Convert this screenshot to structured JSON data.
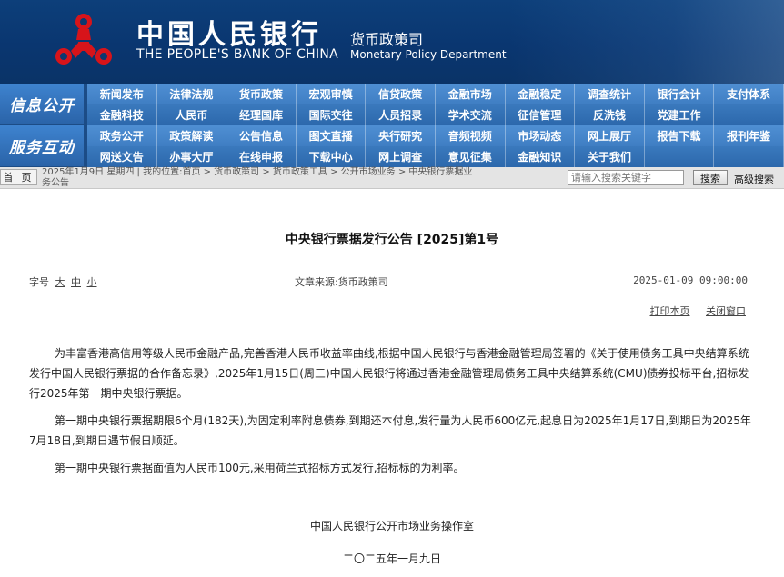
{
  "header": {
    "bank_name_cn": "中国人民银行",
    "bank_name_en": "THE PEOPLE'S BANK OF CHINA",
    "dept_cn": "货币政策司",
    "dept_en": "Monetary Policy Department",
    "brand_color": "#0a3670",
    "logo_color": "#d7141a"
  },
  "nav": {
    "section1": "信息公开",
    "section2": "服务互动",
    "rows": [
      [
        "新闻发布",
        "法律法规",
        "货币政策",
        "宏观审慎",
        "信贷政策",
        "金融市场",
        "金融稳定",
        "调查统计",
        "银行会计",
        "支付体系"
      ],
      [
        "金融科技",
        "人民币",
        "经理国库",
        "国际交往",
        "人员招录",
        "学术交流",
        "征信管理",
        "反洗钱",
        "党建工作",
        ""
      ],
      [
        "政务公开",
        "政策解读",
        "公告信息",
        "图文直播",
        "央行研究",
        "音频视频",
        "市场动态",
        "网上展厅",
        "报告下载",
        "报刊年鉴"
      ],
      [
        "网送文告",
        "办事大厅",
        "在线申报",
        "下载中心",
        "网上调查",
        "意见征集",
        "金融知识",
        "关于我们",
        "",
        ""
      ]
    ]
  },
  "breadcrumb": {
    "home_label": "首 页",
    "line1": "2025年1月9日 星期四 | 我的位置:首页 > 货币政策司 > 货币政策工具 > 公开市场业务 > 中央银行票据业",
    "line2": "务公告",
    "search_placeholder": "请输入搜索关键字",
    "search_button": "搜索",
    "advanced_search": "高级搜索"
  },
  "article": {
    "title": "中央银行票据发行公告 [2025]第1号",
    "font_size_label": "字号",
    "font_large": "大",
    "font_medium": "中",
    "font_small": "小",
    "source": "文章来源:货币政策司",
    "date": "2025-01-09 09:00:00",
    "print_label": "打印本页",
    "close_label": "关闭窗口",
    "paragraphs": [
      "为丰富香港高信用等级人民币金融产品,完善香港人民币收益率曲线,根据中国人民银行与香港金融管理局签署的《关于使用债务工具中央结算系统发行中国人民银行票据的合作备忘录》,2025年1月15日(周三)中国人民银行将通过香港金融管理局债务工具中央结算系统(CMU)债券投标平台,招标发行2025年第一期中央银行票据。",
      "第一期中央银行票据期限6个月(182天),为固定利率附息债券,到期还本付息,发行量为人民币600亿元,起息日为2025年1月17日,到期日为2025年7月18日,到期日遇节假日顺延。",
      "第一期中央银行票据面值为人民币100元,采用荷兰式招标方式发行,招标标的为利率。"
    ],
    "signature": "中国人民银行公开市场业务操作室",
    "sign_date": "二〇二五年一月九日"
  }
}
